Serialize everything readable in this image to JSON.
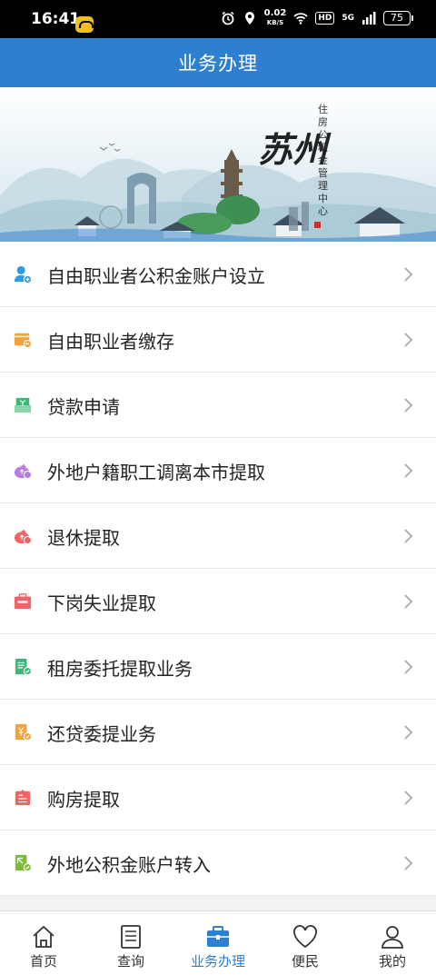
{
  "status_bar": {
    "time": "16:41",
    "speed_value": "0.02",
    "speed_unit": "KB/S",
    "hd": "HD",
    "network": "5G",
    "battery": "75"
  },
  "header": {
    "title": "业务办理"
  },
  "banner": {
    "city": "苏州",
    "org": "住房公积金管理中心"
  },
  "menu": {
    "items": [
      {
        "label": "自由职业者公积金账户设立",
        "icon": "user-add-icon",
        "color": "#2e9be6"
      },
      {
        "label": "自由职业者缴存",
        "icon": "wallet-deposit-icon",
        "color": "#f2a23a"
      },
      {
        "label": "贷款申请",
        "icon": "loan-box-icon",
        "color": "#3fb67a"
      },
      {
        "label": "外地户籍职工调离本市提取",
        "icon": "coin-bag-purple-icon",
        "color": "#b67be8"
      },
      {
        "label": "退休提取",
        "icon": "coin-bag-red-icon",
        "color": "#f06468"
      },
      {
        "label": "下岗失业提取",
        "icon": "unemployed-briefcase-icon",
        "color": "#f06468"
      },
      {
        "label": "租房委托提取业务",
        "icon": "rent-document-icon",
        "color": "#3fb67a"
      },
      {
        "label": "还贷委提业务",
        "icon": "repay-document-icon",
        "color": "#f2a23a"
      },
      {
        "label": "购房提取",
        "icon": "house-purchase-icon",
        "color": "#f06468"
      },
      {
        "label": "外地公积金账户转入",
        "icon": "transfer-in-icon",
        "color": "#7dbb3a"
      }
    ]
  },
  "tabbar": {
    "accent": "#2f7fd0",
    "tabs": [
      {
        "label": "首页",
        "icon": "home-icon",
        "active": false
      },
      {
        "label": "查询",
        "icon": "query-document-icon",
        "active": false
      },
      {
        "label": "业务办理",
        "icon": "briefcase-icon",
        "active": true
      },
      {
        "label": "便民",
        "icon": "heart-icon",
        "active": false
      },
      {
        "label": "我的",
        "icon": "person-icon",
        "active": false
      }
    ]
  }
}
